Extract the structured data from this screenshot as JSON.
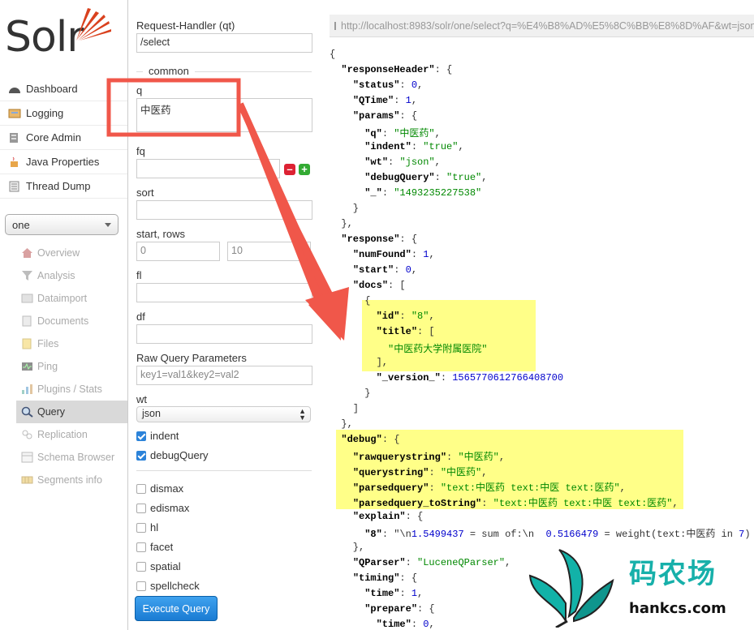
{
  "logo": {
    "text": "Solr"
  },
  "nav": [
    {
      "label": "Dashboard",
      "icon": "dashboard-icon"
    },
    {
      "label": "Logging",
      "icon": "logging-icon"
    },
    {
      "label": "Core Admin",
      "icon": "core-admin-icon"
    },
    {
      "label": "Java Properties",
      "icon": "java-icon"
    },
    {
      "label": "Thread Dump",
      "icon": "thread-dump-icon"
    }
  ],
  "core_selector": {
    "value": "one"
  },
  "core_menu": [
    {
      "label": "Overview",
      "icon": "home-icon"
    },
    {
      "label": "Analysis",
      "icon": "funnel-icon"
    },
    {
      "label": "Dataimport",
      "icon": "dataimport-icon"
    },
    {
      "label": "Documents",
      "icon": "documents-icon"
    },
    {
      "label": "Files",
      "icon": "folder-icon"
    },
    {
      "label": "Ping",
      "icon": "ping-icon"
    },
    {
      "label": "Plugins / Stats",
      "icon": "plugins-icon"
    },
    {
      "label": "Query",
      "icon": "search-icon",
      "active": true
    },
    {
      "label": "Replication",
      "icon": "replication-icon"
    },
    {
      "label": "Schema Browser",
      "icon": "schema-icon"
    },
    {
      "label": "Segments info",
      "icon": "segments-icon"
    }
  ],
  "form": {
    "qt_label": "Request-Handler (qt)",
    "qt_value": "/select",
    "section_common": "common",
    "q_label": "q",
    "q_value": "中医药",
    "fq_label": "fq",
    "sort_label": "sort",
    "start_rows_label": "start, rows",
    "start_value": "0",
    "rows_value": "10",
    "fl_label": "fl",
    "df_label": "df",
    "raw_label": "Raw Query Parameters",
    "raw_placeholder": "key1=val1&key2=val2",
    "wt_label": "wt",
    "wt_value": "json",
    "indent_label": "indent",
    "debug_label": "debugQuery",
    "options": [
      "dismax",
      "edismax",
      "hl",
      "facet",
      "spatial",
      "spellcheck"
    ],
    "execute_label": "Execute Query"
  },
  "url": "http://localhost:8983/solr/one/select?q=%E4%B8%AD%E5%8C%BB%E8%8D%AF&wt=json",
  "json_lines": [
    "{",
    "  \"responseHeader\": {",
    "    \"status\": 0,",
    "    \"QTime\": 1,",
    "    \"params\": {",
    "      \"q\": \"中医药\",",
    "      \"indent\": \"true\",",
    "      \"wt\": \"json\",",
    "      \"debugQuery\": \"true\",",
    "      \"_\": \"1493235227538\"",
    "    }",
    "  },",
    "  \"response\": {",
    "    \"numFound\": 1,",
    "    \"start\": 0,",
    "    \"docs\": [",
    "      {",
    "        \"id\": \"8\",",
    "        \"title\": [",
    "          \"中医药大学附属医院\"",
    "        ],",
    "        \"_version_\": 1565770612766408700",
    "      }",
    "    ]",
    "  },",
    "  \"debug\": {",
    "    \"rawquerystring\": \"中医药\",",
    "    \"querystring\": \"中医药\",",
    "    \"parsedquery\": \"text:中医药 text:中医 text:医药\",",
    "    \"parsedquery_toString\": \"text:中医药 text:中医 text:医药\",",
    "    \"explain\": {",
    "      \"8\": \"\\n1.5499437 = sum of:\\n  0.5166479 = weight(text:中医药 in 7)",
    "    },",
    "    \"QParser\": \"LuceneQParser\",",
    "    \"timing\": {",
    "      \"time\": 1,",
    "      \"prepare\": {",
    "        \"time\": 0,"
  ],
  "watermark": {
    "title": "码农场",
    "subtitle": "hankcs.com"
  },
  "colors": {
    "accent": "#1a7bd3",
    "highlight": "#ffff88",
    "annotation": "#f0574a",
    "brand_teal": "#17b0aa"
  }
}
